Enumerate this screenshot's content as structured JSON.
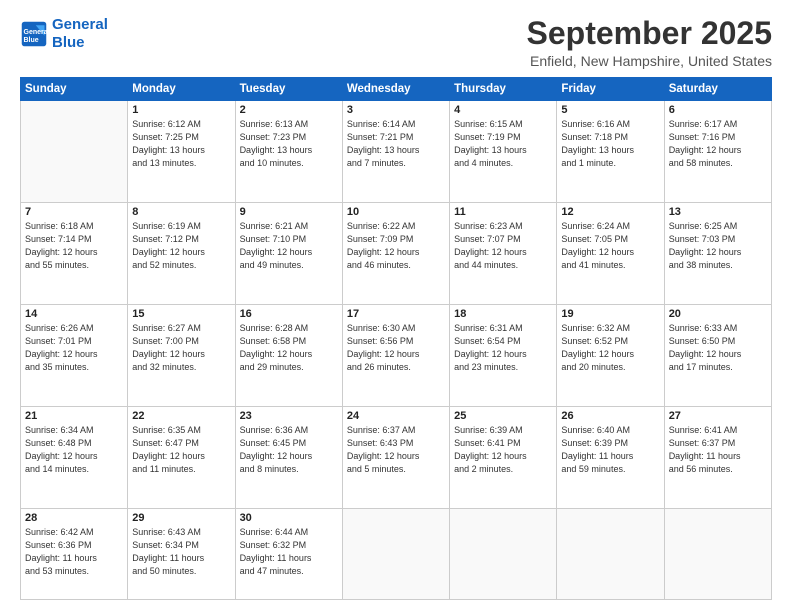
{
  "header": {
    "logo": {
      "line1": "General",
      "line2": "Blue"
    },
    "title": "September 2025",
    "location": "Enfield, New Hampshire, United States"
  },
  "days_of_week": [
    "Sunday",
    "Monday",
    "Tuesday",
    "Wednesday",
    "Thursday",
    "Friday",
    "Saturday"
  ],
  "weeks": [
    [
      {
        "day": "",
        "info": ""
      },
      {
        "day": "1",
        "info": "Sunrise: 6:12 AM\nSunset: 7:25 PM\nDaylight: 13 hours\nand 13 minutes."
      },
      {
        "day": "2",
        "info": "Sunrise: 6:13 AM\nSunset: 7:23 PM\nDaylight: 13 hours\nand 10 minutes."
      },
      {
        "day": "3",
        "info": "Sunrise: 6:14 AM\nSunset: 7:21 PM\nDaylight: 13 hours\nand 7 minutes."
      },
      {
        "day": "4",
        "info": "Sunrise: 6:15 AM\nSunset: 7:19 PM\nDaylight: 13 hours\nand 4 minutes."
      },
      {
        "day": "5",
        "info": "Sunrise: 6:16 AM\nSunset: 7:18 PM\nDaylight: 13 hours\nand 1 minute."
      },
      {
        "day": "6",
        "info": "Sunrise: 6:17 AM\nSunset: 7:16 PM\nDaylight: 12 hours\nand 58 minutes."
      }
    ],
    [
      {
        "day": "7",
        "info": "Sunrise: 6:18 AM\nSunset: 7:14 PM\nDaylight: 12 hours\nand 55 minutes."
      },
      {
        "day": "8",
        "info": "Sunrise: 6:19 AM\nSunset: 7:12 PM\nDaylight: 12 hours\nand 52 minutes."
      },
      {
        "day": "9",
        "info": "Sunrise: 6:21 AM\nSunset: 7:10 PM\nDaylight: 12 hours\nand 49 minutes."
      },
      {
        "day": "10",
        "info": "Sunrise: 6:22 AM\nSunset: 7:09 PM\nDaylight: 12 hours\nand 46 minutes."
      },
      {
        "day": "11",
        "info": "Sunrise: 6:23 AM\nSunset: 7:07 PM\nDaylight: 12 hours\nand 44 minutes."
      },
      {
        "day": "12",
        "info": "Sunrise: 6:24 AM\nSunset: 7:05 PM\nDaylight: 12 hours\nand 41 minutes."
      },
      {
        "day": "13",
        "info": "Sunrise: 6:25 AM\nSunset: 7:03 PM\nDaylight: 12 hours\nand 38 minutes."
      }
    ],
    [
      {
        "day": "14",
        "info": "Sunrise: 6:26 AM\nSunset: 7:01 PM\nDaylight: 12 hours\nand 35 minutes."
      },
      {
        "day": "15",
        "info": "Sunrise: 6:27 AM\nSunset: 7:00 PM\nDaylight: 12 hours\nand 32 minutes."
      },
      {
        "day": "16",
        "info": "Sunrise: 6:28 AM\nSunset: 6:58 PM\nDaylight: 12 hours\nand 29 minutes."
      },
      {
        "day": "17",
        "info": "Sunrise: 6:30 AM\nSunset: 6:56 PM\nDaylight: 12 hours\nand 26 minutes."
      },
      {
        "day": "18",
        "info": "Sunrise: 6:31 AM\nSunset: 6:54 PM\nDaylight: 12 hours\nand 23 minutes."
      },
      {
        "day": "19",
        "info": "Sunrise: 6:32 AM\nSunset: 6:52 PM\nDaylight: 12 hours\nand 20 minutes."
      },
      {
        "day": "20",
        "info": "Sunrise: 6:33 AM\nSunset: 6:50 PM\nDaylight: 12 hours\nand 17 minutes."
      }
    ],
    [
      {
        "day": "21",
        "info": "Sunrise: 6:34 AM\nSunset: 6:48 PM\nDaylight: 12 hours\nand 14 minutes."
      },
      {
        "day": "22",
        "info": "Sunrise: 6:35 AM\nSunset: 6:47 PM\nDaylight: 12 hours\nand 11 minutes."
      },
      {
        "day": "23",
        "info": "Sunrise: 6:36 AM\nSunset: 6:45 PM\nDaylight: 12 hours\nand 8 minutes."
      },
      {
        "day": "24",
        "info": "Sunrise: 6:37 AM\nSunset: 6:43 PM\nDaylight: 12 hours\nand 5 minutes."
      },
      {
        "day": "25",
        "info": "Sunrise: 6:39 AM\nSunset: 6:41 PM\nDaylight: 12 hours\nand 2 minutes."
      },
      {
        "day": "26",
        "info": "Sunrise: 6:40 AM\nSunset: 6:39 PM\nDaylight: 11 hours\nand 59 minutes."
      },
      {
        "day": "27",
        "info": "Sunrise: 6:41 AM\nSunset: 6:37 PM\nDaylight: 11 hours\nand 56 minutes."
      }
    ],
    [
      {
        "day": "28",
        "info": "Sunrise: 6:42 AM\nSunset: 6:36 PM\nDaylight: 11 hours\nand 53 minutes."
      },
      {
        "day": "29",
        "info": "Sunrise: 6:43 AM\nSunset: 6:34 PM\nDaylight: 11 hours\nand 50 minutes."
      },
      {
        "day": "30",
        "info": "Sunrise: 6:44 AM\nSunset: 6:32 PM\nDaylight: 11 hours\nand 47 minutes."
      },
      {
        "day": "",
        "info": ""
      },
      {
        "day": "",
        "info": ""
      },
      {
        "day": "",
        "info": ""
      },
      {
        "day": "",
        "info": ""
      }
    ]
  ]
}
